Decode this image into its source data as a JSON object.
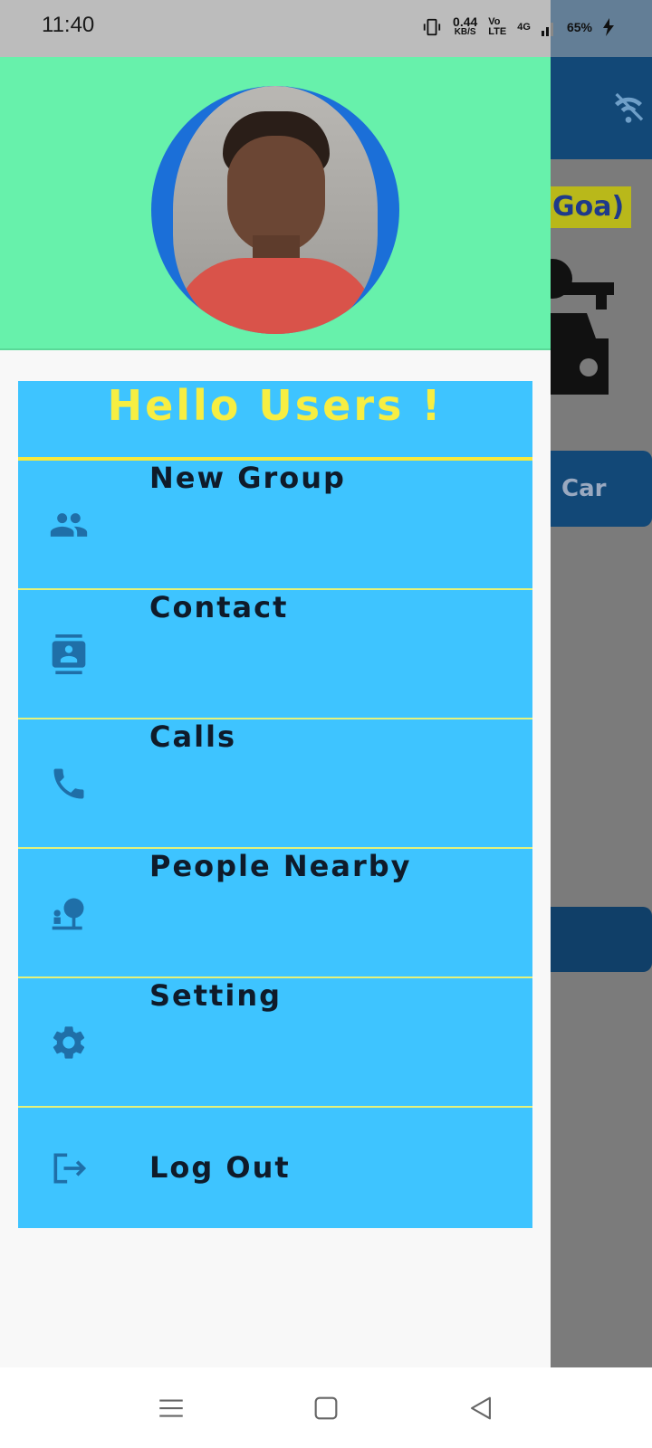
{
  "status_bar": {
    "time": "11:40",
    "speed_value": "0.44",
    "speed_unit": "KB/S",
    "volte": "Vo LTE",
    "network": "4G",
    "battery": "65%"
  },
  "background": {
    "title_fragment": "Goa)",
    "button_label": "Car"
  },
  "drawer": {
    "header_title": "Hello Users !",
    "items": [
      {
        "label": "New Group",
        "icon": "group-icon"
      },
      {
        "label": "Contact",
        "icon": "contact-icon"
      },
      {
        "label": "Calls",
        "icon": "phone-icon"
      },
      {
        "label": "People Nearby",
        "icon": "people-nearby-icon"
      },
      {
        "label": "Setting",
        "icon": "gear-icon"
      },
      {
        "label": "Log Out",
        "icon": "logout-icon"
      }
    ]
  },
  "colors": {
    "header_bg": "#67f1ab",
    "panel_bg": "#3ec4ff",
    "title_yellow": "#f7ee42",
    "icon_blue": "#1f6fa8",
    "avatar_ring": "#1b6fd8"
  }
}
